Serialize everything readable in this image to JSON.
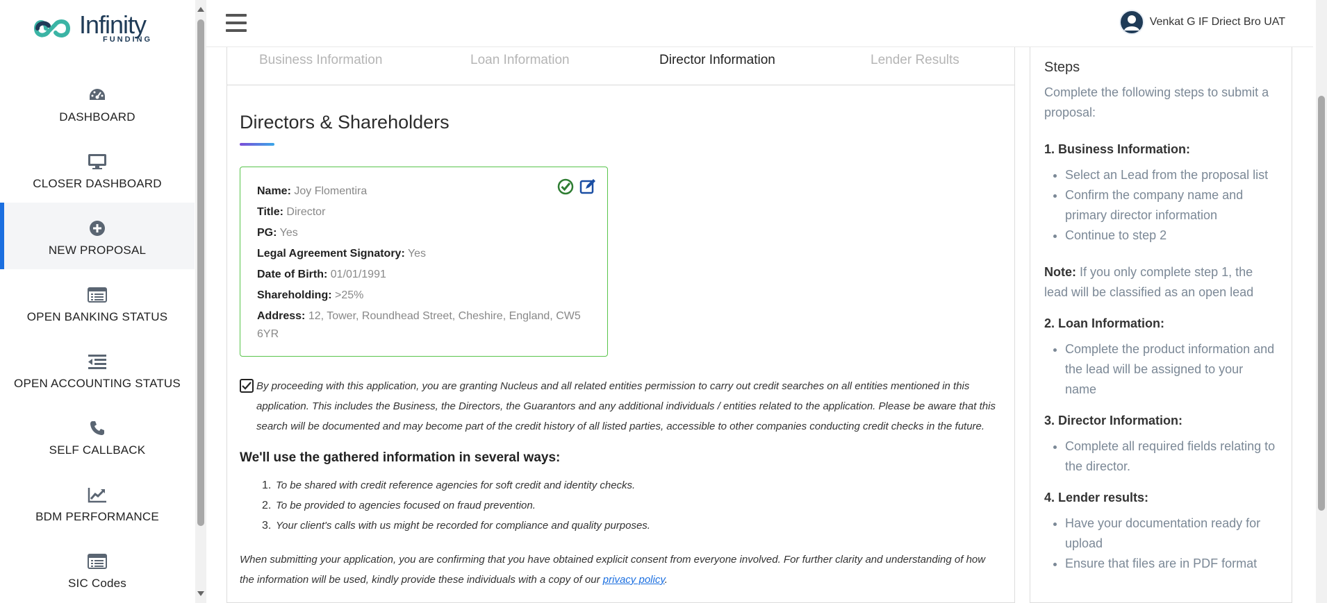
{
  "app": {
    "brand_main": "Infinity",
    "brand_sub": "FUNDING",
    "brand_color": "#1f3b57"
  },
  "sidebar": {
    "items": [
      {
        "label": "DASHBOARD",
        "icon": "dashboard-gauge-icon",
        "active": false
      },
      {
        "label": "CLOSER DASHBOARD",
        "icon": "monitor-icon",
        "active": false
      },
      {
        "label": "NEW PROPOSAL",
        "icon": "plus-circle-icon",
        "active": true
      },
      {
        "label": "OPEN BANKING STATUS",
        "icon": "list-window-icon",
        "active": false
      },
      {
        "label": "OPEN ACCOUNTING STATUS",
        "icon": "outdent-list-icon",
        "active": false
      },
      {
        "label": "SELF CALLBACK",
        "icon": "phone-icon",
        "active": false
      },
      {
        "label": "BDM PERFORMANCE",
        "icon": "line-chart-icon",
        "active": false
      },
      {
        "label": "SIC Codes",
        "icon": "list-window-icon",
        "active": false
      }
    ],
    "accent_color": "#1b6fe0"
  },
  "header": {
    "user_name": "Venkat G IF Driect Bro UAT"
  },
  "tabs": [
    {
      "label": "Business Information",
      "active": false
    },
    {
      "label": "Loan Information",
      "active": false
    },
    {
      "label": "Director Information",
      "active": true
    },
    {
      "label": "Lender Results",
      "active": false
    }
  ],
  "main": {
    "title": "Directors & Shareholders",
    "director": {
      "name_label": "Name:",
      "name": "Joy Flomentira",
      "title_label": "Title:",
      "title": "Director",
      "pg_label": "PG:",
      "pg": "Yes",
      "signatory_label": "Legal Agreement Signatory:",
      "signatory": "Yes",
      "dob_label": "Date of Birth:",
      "dob": "01/01/1991",
      "shareholding_label": "Shareholding:",
      "shareholding": ">25%",
      "address_label": "Address:",
      "address": "12, Tower, Roundhead Street, Cheshire, England, CW5 6YR"
    },
    "consent_checked": true,
    "consent_text": "By proceeding with this application, you are granting Nucleus and all related entities permission to carry out credit searches on all entities mentioned in this application. This includes the Business, the Directors, the Guarantors and any additional individuals / entities related to the application. Please be aware that this search will be documented and may become part of the credit history of all listed parties, accessible to other companies conducting credit checks in the future.",
    "uses_heading": "We'll use the gathered information in several ways:",
    "uses": [
      {
        "num": "1.",
        "text": "To be shared with credit reference agencies for soft credit and identity checks."
      },
      {
        "num": "2.",
        "text": "To be provided to agencies focused on fraud prevention."
      },
      {
        "num": "3.",
        "text": "Your client's calls with us might be recorded for compliance and quality purposes."
      }
    ],
    "submit_note": "When submitting your application, you are confirming that you have obtained explicit consent from everyone involved. For further clarity and understanding of how the information will be used, kindly provide these individuals with a copy of our",
    "privacy_link": "privacy policy",
    "submit_note_end": "."
  },
  "steps": {
    "heading": "Steps",
    "intro": "Complete the following steps to submit a proposal:",
    "step1_title": "1. Business Information:",
    "step1_items": [
      "Select an Lead from the proposal list",
      "Confirm the company name and primary director information",
      "Continue to step 2"
    ],
    "note_label": "Note:",
    "note_text": "If you only complete step 1, the lead will be classified as an open lead",
    "step2_title": "2. Loan Information:",
    "step2_items": [
      "Complete the product information and the lead will be assigned to your name"
    ],
    "step3_title": "3. Director Information:",
    "step3_items": [
      "Complete all required fields relating to the director."
    ],
    "step4_title": "4. Lender results:",
    "step4_items": [
      "Have your documentation ready for upload",
      "Ensure that files are in PDF format"
    ]
  }
}
